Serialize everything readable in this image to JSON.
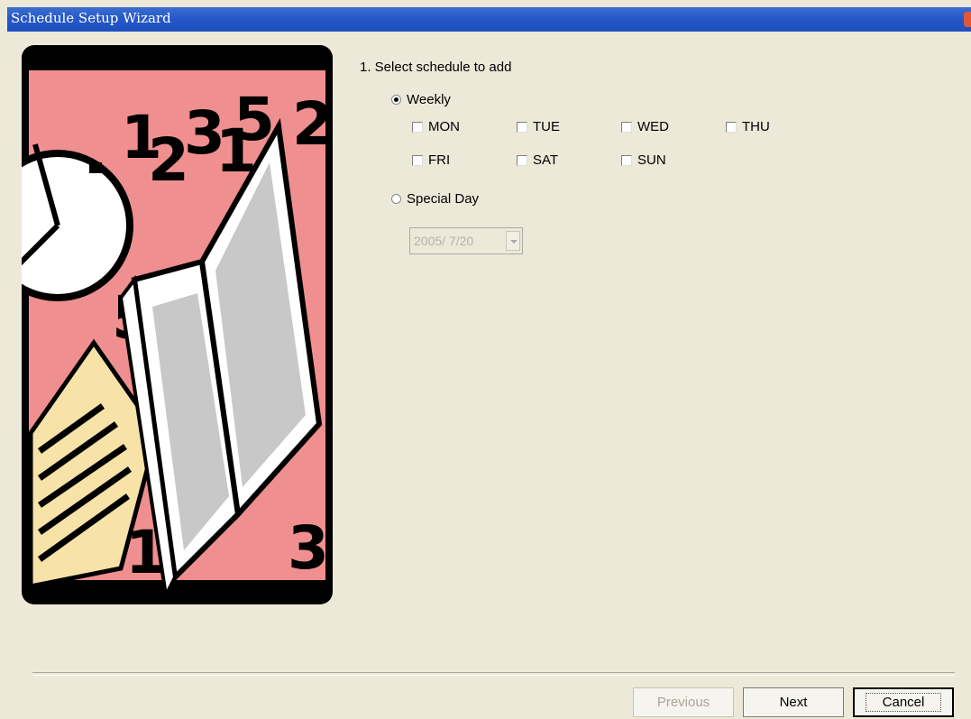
{
  "window": {
    "title": "Schedule Setup Wizard"
  },
  "step": {
    "caption": "1. Select schedule to add"
  },
  "weekly": {
    "label": "Weekly",
    "selected": true,
    "days": [
      {
        "label": "MON",
        "checked": false
      },
      {
        "label": "TUE",
        "checked": false
      },
      {
        "label": "WED",
        "checked": false
      },
      {
        "label": "THU",
        "checked": false
      },
      {
        "label": "FRI",
        "checked": false
      },
      {
        "label": "SAT",
        "checked": false
      },
      {
        "label": "SUN",
        "checked": false
      }
    ]
  },
  "special": {
    "label": "Special Day",
    "selected": false,
    "date_value": "2005/ 7/20",
    "disabled": true
  },
  "buttons": {
    "previous": "Previous",
    "next": "Next",
    "cancel": "Cancel"
  },
  "colors": {
    "title_bar": "#2457c7",
    "dialog_bg": "#ece9d8",
    "illustration_pink": "#f08a8a"
  },
  "icons": [
    "close-icon",
    "dropdown-arrow-icon"
  ]
}
